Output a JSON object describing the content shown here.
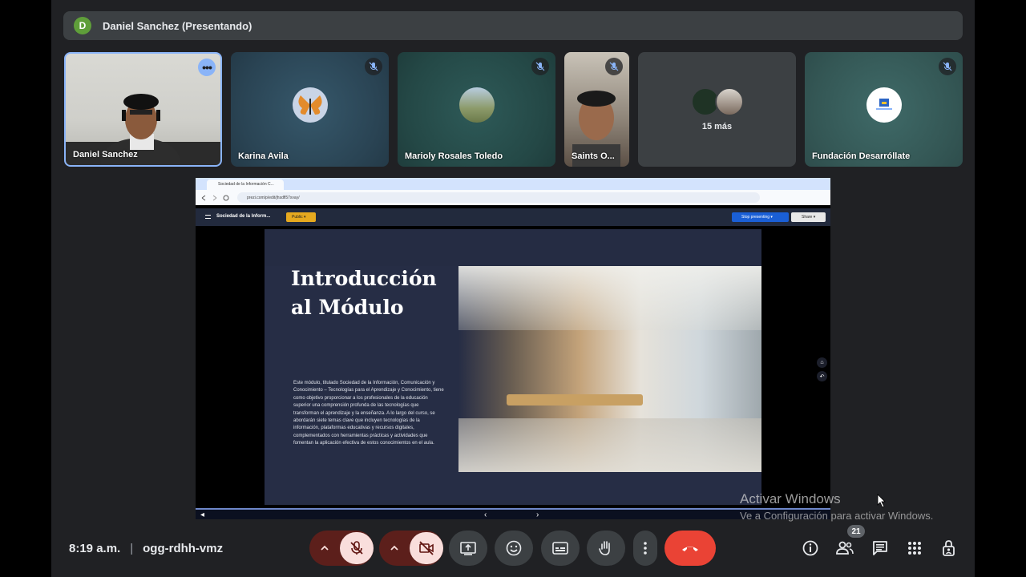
{
  "presenter_bar": {
    "avatar_letter": "D",
    "text": "Daniel Sanchez (Presentando)"
  },
  "tiles": [
    {
      "label": "Daniel Sanchez"
    },
    {
      "label": "Karina Avila"
    },
    {
      "label": "Marioly Rosales Toledo"
    },
    {
      "label": "Saints O..."
    },
    {
      "label": "",
      "more_label": "15 más"
    },
    {
      "label": "Fundación Desarróllate"
    }
  ],
  "browser": {
    "tab_title": "Sociedad de la Información C...",
    "url": "prezi.com/p/edit/jhsdfl57xvay/"
  },
  "prezi": {
    "title": "Sociedad de la Inform...",
    "public_label": "Public ▾",
    "stop_label": "Stop presenting ▾",
    "share_label": "Share ▾"
  },
  "slide": {
    "heading_line1": "Introducción",
    "heading_line2": "al Módulo",
    "body": "Este módulo, titulado Sociedad de la Información, Comunicación y Conocimiento – Tecnologías para el Aprendizaje y Conocimiento, tiene como objetivo proporcionar a los profesionales de la educación superior una comprensión profunda de las tecnologías que transforman el aprendizaje y la enseñanza. A lo largo del curso, se abordarán siete temas clave que incluyen tecnologías de la información, plataformas educativas y recursos digitales, complementados con herramientas prácticas y actividades que fomentan la aplicación efectiva de estos conocimientos en el aula."
  },
  "watermark": {
    "line1": "Activar Windows",
    "line2": "Ve a Configuración para activar Windows."
  },
  "meeting": {
    "time": "8:19 a.m.",
    "code": "ogg-rdhh-vmz",
    "participants_count": "21"
  },
  "colors": {
    "background": "#202124",
    "end_call": "#ea4335",
    "muted_pill": "#f9dedc",
    "active_border": "#8ab4f8"
  }
}
